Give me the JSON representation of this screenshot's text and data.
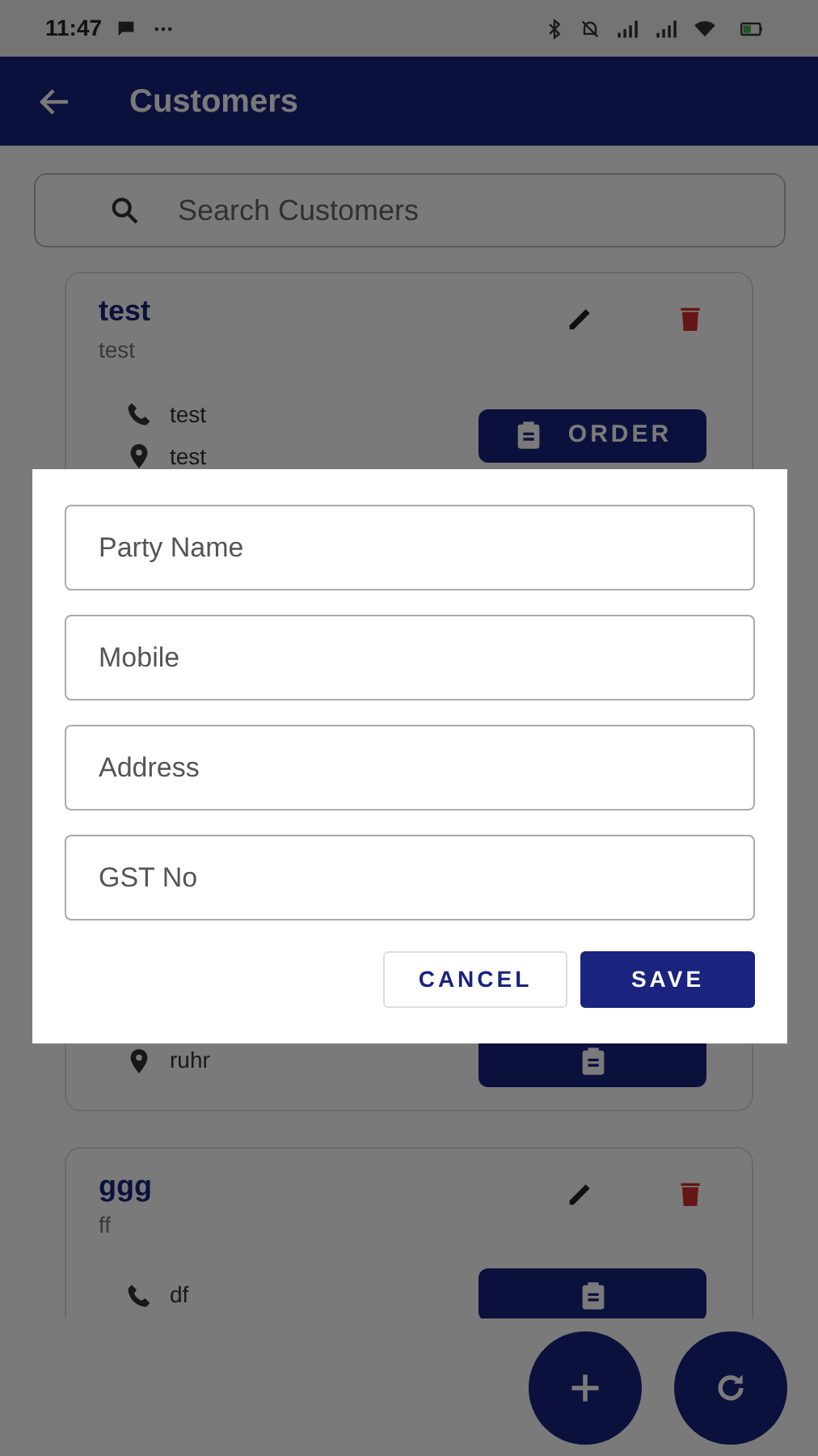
{
  "status_bar": {
    "time": "11:47"
  },
  "app_bar": {
    "title": "Customers"
  },
  "search": {
    "placeholder": "Search Customers"
  },
  "customers": [
    {
      "name": "test",
      "subtitle": "test",
      "phone": "test",
      "address": "test",
      "order_label": "ORDER"
    },
    {
      "address": "ruhr"
    },
    {
      "name": "ggg",
      "subtitle": "ff",
      "phone": "df"
    }
  ],
  "dialog": {
    "fields": [
      {
        "placeholder": "Party Name"
      },
      {
        "placeholder": "Mobile"
      },
      {
        "placeholder": "Address"
      },
      {
        "placeholder": "GST No"
      }
    ],
    "buttons": [
      {
        "label": "CANCEL",
        "kind": "outline"
      },
      {
        "label": "SAVE",
        "kind": "primary"
      }
    ]
  }
}
